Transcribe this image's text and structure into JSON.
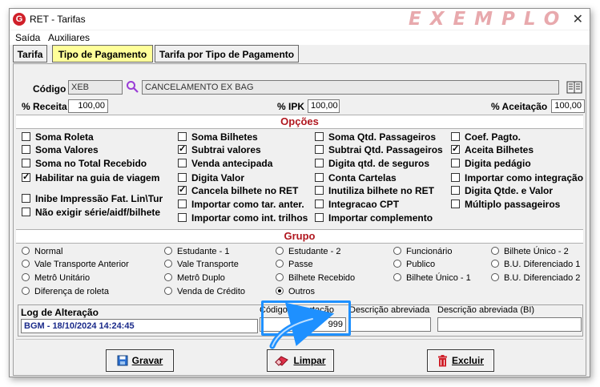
{
  "window": {
    "title": "RET - Tarifas",
    "watermark": "EXEMPLO",
    "close": "✕",
    "logo": "G"
  },
  "menu": [
    "Saída",
    "Auxiliares"
  ],
  "tabs": [
    "Tarifa",
    "Tipo de Pagamento",
    "Tarifa por Tipo de Pagamento"
  ],
  "codigo": {
    "label": "Código",
    "code": "XEB",
    "description": "CANCELAMENTO EX BAG"
  },
  "percent": {
    "receita_label": "% Receita",
    "receita": "100,00",
    "ipk_label": "% IPK",
    "ipk": "100,00",
    "aceitacao_label": "% Aceitação",
    "aceitacao": "100,00"
  },
  "opcoes": {
    "title": "Opções",
    "items": [
      {
        "label": "Soma Roleta",
        "checked": false
      },
      {
        "label": "Soma Valores",
        "checked": false
      },
      {
        "label": "Soma no Total Recebido",
        "checked": false
      },
      {
        "label": "Habilitar na guia de viagem",
        "checked": true
      },
      {
        "label": "Inibe Impressão Fat. Lin\\Tur",
        "checked": false
      },
      {
        "label": "Não exigir série/aidf/bilhete",
        "checked": false
      },
      {
        "label": "Soma Bilhetes",
        "checked": false
      },
      {
        "label": "Subtrai valores",
        "checked": true
      },
      {
        "label": "Venda antecipada",
        "checked": false
      },
      {
        "label": "Digita Valor",
        "checked": false
      },
      {
        "label": "Cancela bilhete no RET",
        "checked": true
      },
      {
        "label": "Importar como tar. anter.",
        "checked": false
      },
      {
        "label": "Importar como int. trilhos",
        "checked": false
      },
      {
        "label": "Soma Qtd. Passageiros",
        "checked": false
      },
      {
        "label": "Subtrai Qtd. Passageiros",
        "checked": false
      },
      {
        "label": "Digita qtd. de seguros",
        "checked": false
      },
      {
        "label": "Conta Cartelas",
        "checked": false
      },
      {
        "label": "Inutiliza bilhete no RET",
        "checked": false
      },
      {
        "label": "Integracao CPT",
        "checked": false
      },
      {
        "label": "Importar complemento",
        "checked": false
      },
      {
        "label": "Coef. Pagto.",
        "checked": false
      },
      {
        "label": "Aceita Bilhetes",
        "checked": true
      },
      {
        "label": "Digita pedágio",
        "checked": false
      },
      {
        "label": "Importar como integração",
        "checked": false
      },
      {
        "label": "Digita Qtde. e Valor",
        "checked": false
      },
      {
        "label": "Múltiplo passageiros",
        "checked": false
      }
    ]
  },
  "grupo": {
    "title": "Grupo",
    "items": [
      "Normal",
      "Vale Transporte Anterior",
      "Metrô Unitário",
      "Diferença de roleta",
      "Estudante - 1",
      "Vale Transporte",
      "Metrô Duplo",
      "Venda de Crédito",
      "Estudante - 2",
      "Passe",
      "Bilhete Recebido",
      "Outros",
      "Funcionário",
      "Publico",
      "Bilhete Único - 1",
      "Bilhete Único - 2",
      "B.U. Diferenciado 1",
      "B.U. Diferenciado 2"
    ],
    "selected": "Outros"
  },
  "log": {
    "label": "Log de Alteração",
    "value": "BGM - 18/10/2024 14:24:45",
    "codigo_importacao_label": "Código Importação",
    "codigo_importacao": "999",
    "desc_abrev_label": "Descrição abreviada",
    "desc_abrev": "",
    "desc_abrev_bi_label": "Descrição abreviada (BI)",
    "desc_abrev_bi": ""
  },
  "buttons": {
    "gravar": "Gravar",
    "limpar": "Limpar",
    "excluir": "Excluir"
  },
  "colors": {
    "accent": "#1e90ff",
    "section_title": "#b0171f",
    "active_tab": "#ffff99",
    "watermark": "#e8a9ad"
  }
}
